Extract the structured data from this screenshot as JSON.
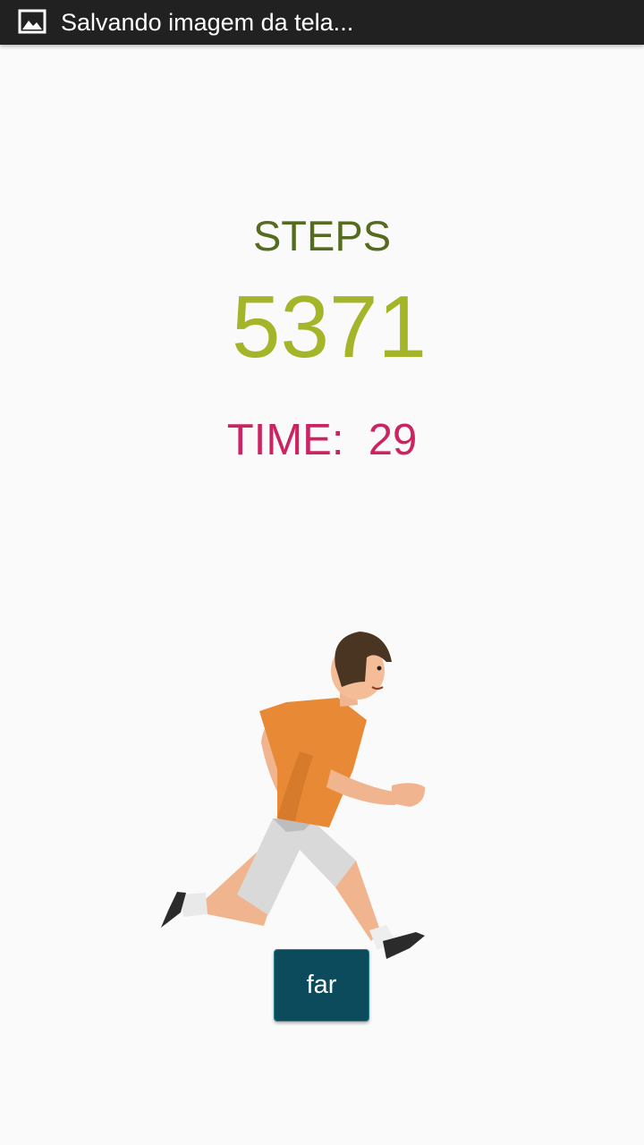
{
  "status_bar": {
    "icon": "image-icon",
    "text": "Salvando imagem da tela..."
  },
  "steps": {
    "label": "STEPS",
    "value": "5371"
  },
  "time": {
    "label": "TIME:",
    "value": "29"
  },
  "illustration": {
    "icon": "running-man-illustration"
  },
  "far_button": {
    "label": "far"
  },
  "colors": {
    "steps_label": "#556b1f",
    "steps_value": "#a4b52a",
    "time": "#cc2462",
    "button": "#0b4b5b",
    "status_bar": "#212121"
  }
}
